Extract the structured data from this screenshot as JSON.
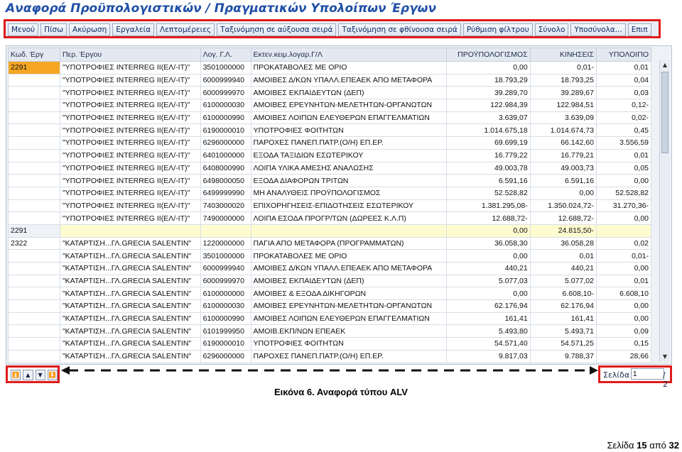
{
  "page_title": "Αναφορά Προϋπολογιστικών / Πραγματικών Υπολοίπων Έργων",
  "toolbar": {
    "buttons": [
      "Μενού",
      "Πίσω",
      "Ακύρωση",
      "Εργαλεία",
      "Λεπτομέρειες",
      "Ταξινόμηση σε αύξουσα σειρά",
      "Ταξινόμηση σε φθίνουσα σειρά",
      "Ρύθμιση φίλτρου",
      "Σύνολο",
      "Υποσύνολα...",
      "Επιπ"
    ]
  },
  "grid": {
    "columns": [
      "Κωδ. Έργ",
      "Περ. Έργου",
      "Λογ. Γ.Λ.",
      "Εκτεν.κειμ.λογαρ.Γ/Λ",
      "ΠΡΟΫΠΟΛΟΓΙΣΜΟΣ",
      "ΚΙΝΗΣΕΙΣ",
      "ΥΠΟΛΟΙΠΟ"
    ],
    "rows": [
      {
        "code": "2291",
        "desc": "\"ΥΠΟΤΡΟΦΙΕΣ INTERREG II(ΕΛ/-IT)\"",
        "account": "3501000000",
        "account_text": "ΠΡΟΚΑΤΑΒΟΛΕΣ ΜΕ ΟΡΙΟ",
        "budget": "0,00",
        "movements": "0,01-",
        "balance": "0,01"
      },
      {
        "code": "",
        "desc": "\"ΥΠΟΤΡΟΦΙΕΣ INTERREG II(ΕΛ/-IT)\"",
        "account": "6000999940",
        "account_text": "ΑΜΟΙΒΕΣ Δ/ΚΩΝ ΥΠΑΛΛ.ΕΠΕΑΕΚ ΑΠΟ ΜΕΤΑΦΟΡΑ",
        "budget": "18.793,29",
        "movements": "18.793,25",
        "balance": "0,04"
      },
      {
        "code": "",
        "desc": "\"ΥΠΟΤΡΟΦΙΕΣ INTERREG II(ΕΛ/-IT)\"",
        "account": "6000999970",
        "account_text": "ΑΜΟΙΒΕΣ ΕΚΠΑΙΔΕΥΤΩΝ (ΔΕΠ)",
        "budget": "39.289,70",
        "movements": "39.289,67",
        "balance": "0,03"
      },
      {
        "code": "",
        "desc": "\"ΥΠΟΤΡΟΦΙΕΣ INTERREG II(ΕΛ/-IT)\"",
        "account": "6100000030",
        "account_text": "ΑΜΟΙΒΕΣ ΕΡΕΥΝΗΤΩΝ-ΜΕΛΕΤΗΤΩΝ-ΟΡΓΑΝΩΤΩΝ",
        "budget": "122.984,39",
        "movements": "122.984,51",
        "balance": "0,12-"
      },
      {
        "code": "",
        "desc": "\"ΥΠΟΤΡΟΦΙΕΣ INTERREG II(ΕΛ/-IT)\"",
        "account": "6100000990",
        "account_text": "ΑΜΟΙΒΕΣ ΛΟΙΠΩΝ ΕΛΕΥΘΕΡΩΝ ΕΠΑΓΓΕΛΜΑΤΙΩΝ",
        "budget": "3.639,07",
        "movements": "3.639,09",
        "balance": "0,02-"
      },
      {
        "code": "",
        "desc": "\"ΥΠΟΤΡΟΦΙΕΣ INTERREG II(ΕΛ/-IT)\"",
        "account": "6190000010",
        "account_text": "ΥΠΟΤΡΟΦΙΕΣ ΦΟΙΤΗΤΩΝ",
        "budget": "1.014.675,18",
        "movements": "1.014.674,73",
        "balance": "0,45"
      },
      {
        "code": "",
        "desc": "\"ΥΠΟΤΡΟΦΙΕΣ INTERREG II(ΕΛ/-IT)\"",
        "account": "6296000000",
        "account_text": "ΠΑΡΟΧΕΣ ΠΑΝΕΠ.ΠΑΤΡ.(Ο/Η) ΕΠ.ΕΡ.",
        "budget": "69.699,19",
        "movements": "66.142,60",
        "balance": "3.556,59"
      },
      {
        "code": "",
        "desc": "\"ΥΠΟΤΡΟΦΙΕΣ INTERREG II(ΕΛ/-IT)\"",
        "account": "6401000000",
        "account_text": "ΕΞΟΔΑ ΤΑΞΙΔΙΩΝ ΕΣΩΤΕΡΙΚΟΥ",
        "budget": "16.779,22",
        "movements": "16.779,21",
        "balance": "0,01"
      },
      {
        "code": "",
        "desc": "\"ΥΠΟΤΡΟΦΙΕΣ INTERREG II(ΕΛ/-IT)\"",
        "account": "6408000990",
        "account_text": "ΛΟΙΠΑ ΥΛΙΚΑ ΑΜΕΣΗΣ ΑΝΑΛΩΣΗΣ",
        "budget": "49.003,78",
        "movements": "49.003,73",
        "balance": "0,05"
      },
      {
        "code": "",
        "desc": "\"ΥΠΟΤΡΟΦΙΕΣ INTERREG II(ΕΛ/-IT)\"",
        "account": "6498000050",
        "account_text": "ΕΞΟΔΑ ΔΙΑΦΟΡΩΝ ΤΡΙΤΩΝ",
        "budget": "6.591,16",
        "movements": "6.591,16",
        "balance": "0,00"
      },
      {
        "code": "",
        "desc": "\"ΥΠΟΤΡΟΦΙΕΣ INTERREG II(ΕΛ/-IT)\"",
        "account": "6499999990",
        "account_text": "ΜΗ ΑΝΑΛΥΘΕΙΣ ΠΡΟΫΠΟΛΟΓΙΣΜΟΣ",
        "budget": "52.528,82",
        "movements": "0,00",
        "balance": "52.528,82"
      },
      {
        "code": "",
        "desc": "\"ΥΠΟΤΡΟΦΙΕΣ INTERREG II(ΕΛ/-IT)\"",
        "account": "7403000020",
        "account_text": "ΕΠΙΧΟΡΗΓΗΣΕΙΣ-ΕΠΙΔΟΤΗΣΕΙΣ ΕΣΩΤΕΡΙΚΟΥ",
        "budget": "1.381.295,08-",
        "movements": "1.350.024,72-",
        "balance": "31.270,36-"
      },
      {
        "code": "",
        "desc": "\"ΥΠΟΤΡΟΦΙΕΣ INTERREG II(ΕΛ/-IT)\"",
        "account": "7490000000",
        "account_text": "ΛΟΙΠΑ ΕΣΟΔΑ ΠΡΟΓΡ/ΤΩΝ (ΔΩΡΕΕΣ Κ.Λ.Π)",
        "budget": "12.688,72-",
        "movements": "12.688,72-",
        "balance": "0,00"
      },
      {
        "code": "2291",
        "subtotal": true,
        "desc": "",
        "account": "",
        "account_text": "",
        "budget": "0,00",
        "movements": "24.815,50-",
        "balance": ""
      },
      {
        "code": "2322",
        "desc": "\"ΚΑΤΑΡΤΙΣΗ...ΓΛ.GRECIA SALENTIN\"",
        "account": "1220000000",
        "account_text": "ΠΑΓΙΑ ΑΠΟ ΜΕΤΑΦΟΡΑ (ΠΡΟΓΡΑΜΜΑΤΩΝ)",
        "budget": "36.058,30",
        "movements": "36.058,28",
        "balance": "0,02"
      },
      {
        "code": "",
        "desc": "\"ΚΑΤΑΡΤΙΣΗ...ΓΛ.GRECIA SALENTIN\"",
        "account": "3501000000",
        "account_text": "ΠΡΟΚΑΤΑΒΟΛΕΣ ΜΕ ΟΡΙΟ",
        "budget": "0,00",
        "movements": "0,01",
        "balance": "0,01-"
      },
      {
        "code": "",
        "desc": "\"ΚΑΤΑΡΤΙΣΗ...ΓΛ.GRECIA SALENTIN\"",
        "account": "6000999940",
        "account_text": "ΑΜΟΙΒΕΣ Δ/ΚΩΝ ΥΠΑΛΛ.ΕΠΕΑΕΚ ΑΠΟ ΜΕΤΑΦΟΡΑ",
        "budget": "440,21",
        "movements": "440,21",
        "balance": "0,00"
      },
      {
        "code": "",
        "desc": "\"ΚΑΤΑΡΤΙΣΗ...ΓΛ.GRECIA SALENTIN\"",
        "account": "6000999970",
        "account_text": "ΑΜΟΙΒΕΣ ΕΚΠΑΙΔΕΥΤΩΝ (ΔΕΠ)",
        "budget": "5.077,03",
        "movements": "5.077,02",
        "balance": "0,01"
      },
      {
        "code": "",
        "desc": "\"ΚΑΤΑΡΤΙΣΗ...ΓΛ.GRECIA SALENTIN\"",
        "account": "6100000000",
        "account_text": "ΑΜΟΙΒΕΣ & ΕΞΟΔΑ ΔΙΚΗΓΟΡΩΝ",
        "budget": "0,00",
        "movements": "6.608,10-",
        "balance": "6.608,10"
      },
      {
        "code": "",
        "desc": "\"ΚΑΤΑΡΤΙΣΗ...ΓΛ.GRECIA SALENTIN\"",
        "account": "6100000030",
        "account_text": "ΑΜΟΙΒΕΣ ΕΡΕΥΝΗΤΩΝ-ΜΕΛΕΤΗΤΩΝ-ΟΡΓΑΝΩΤΩΝ",
        "budget": "62.176,94",
        "movements": "62.176,94",
        "balance": "0,00"
      },
      {
        "code": "",
        "desc": "\"ΚΑΤΑΡΤΙΣΗ...ΓΛ.GRECIA SALENTIN\"",
        "account": "6100000990",
        "account_text": "ΑΜΟΙΒΕΣ ΛΟΙΠΩΝ ΕΛΕΥΘΕΡΩΝ ΕΠΑΓΓΕΛΜΑΤΙΩΝ",
        "budget": "161,41",
        "movements": "161,41",
        "balance": "0,00"
      },
      {
        "code": "",
        "desc": "\"ΚΑΤΑΡΤΙΣΗ...ΓΛ.GRECIA SALENTIN\"",
        "account": "6101999950",
        "account_text": "ΑΜΟΙΒ.ΕΚΠ/ΝΩΝ ΕΠΕΑΕΚ",
        "budget": "5.493,80",
        "movements": "5.493,71",
        "balance": "0,09"
      },
      {
        "code": "",
        "desc": "\"ΚΑΤΑΡΤΙΣΗ...ΓΛ.GRECIA SALENTIN\"",
        "account": "6190000010",
        "account_text": "ΥΠΟΤΡΟΦΙΕΣ ΦΟΙΤΗΤΩΝ",
        "budget": "54.571,40",
        "movements": "54.571,25",
        "balance": "0,15"
      },
      {
        "code": "",
        "desc": "\"ΚΑΤΑΡΤΙΣΗ...ΓΛ.GRECIA SALENTIN\"",
        "account": "6296000000",
        "account_text": "ΠΑΡΟΧΕΣ ΠΑΝΕΠ.ΠΑΤΡ.(Ο/Η) ΕΠ.ΕΡ.",
        "budget": "9.817,03",
        "movements": "9.788,37",
        "balance": "28,66"
      }
    ]
  },
  "pager": {
    "label": "Σελίδα",
    "value": "1",
    "total": "/ 2"
  },
  "caption": "Εικόνα 6. Αναφορά τύπου ALV",
  "footer": {
    "prefix": "Σελίδα",
    "current": "15",
    "middle": "από",
    "total": "32"
  },
  "colors": {
    "title": "#1f4fa6",
    "highlight_box": "#e01b1b",
    "selected_cell": "#f5a623",
    "subtotal_row": "#fffbd0"
  }
}
